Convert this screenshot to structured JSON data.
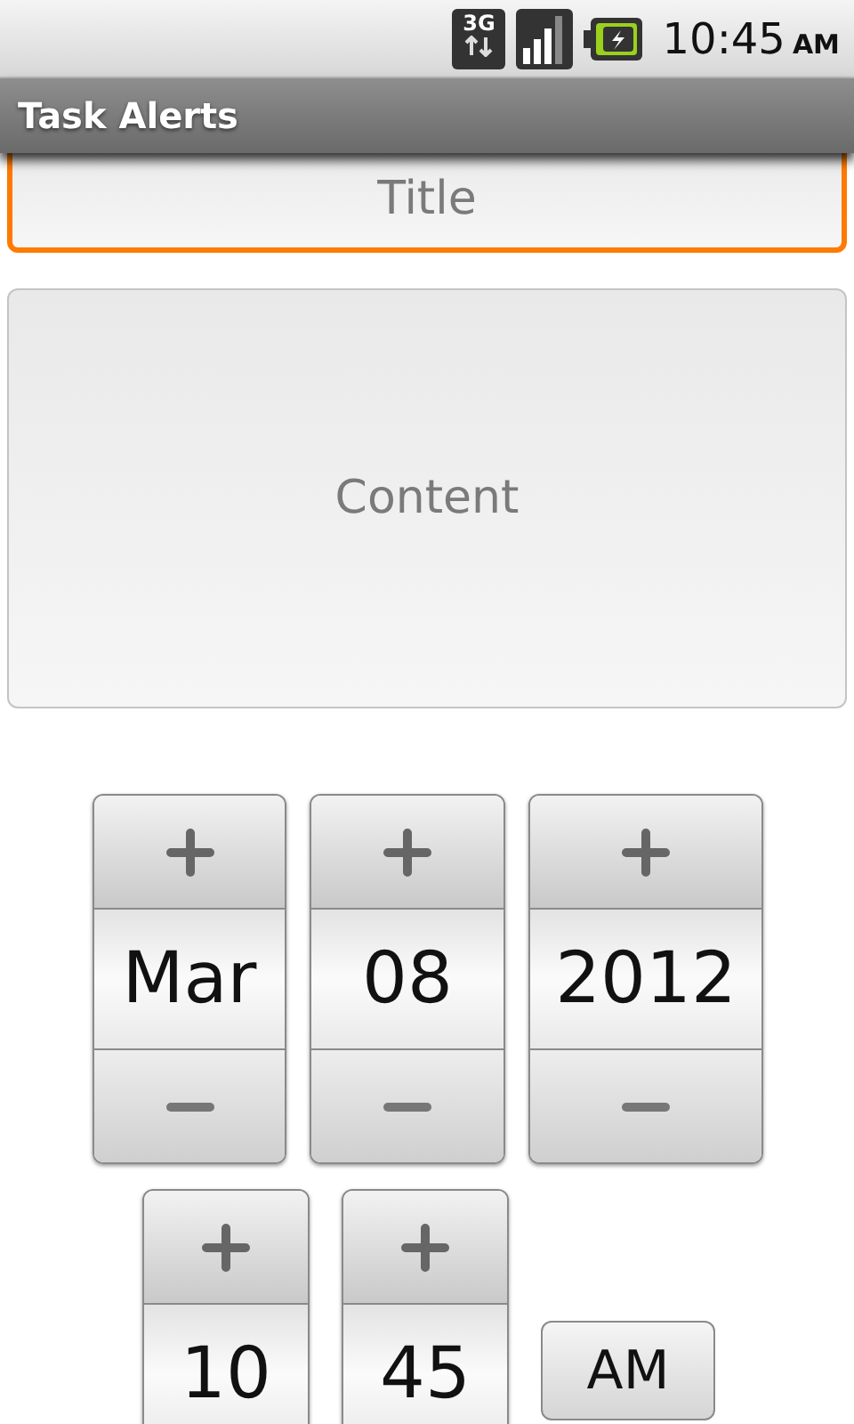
{
  "status_bar": {
    "network": "3G",
    "time": "10:45",
    "meridiem": "AM"
  },
  "title_bar": {
    "title": "Task Alerts"
  },
  "title_field": {
    "placeholder": "Title",
    "focused": true
  },
  "content_field": {
    "placeholder": "Content",
    "focused": false
  },
  "date_picker": [
    {
      "value": "Mar"
    },
    {
      "value": "08"
    },
    {
      "value": "2012"
    }
  ],
  "time_picker": [
    {
      "value": "10"
    },
    {
      "value": "45"
    }
  ],
  "meridiem_button": {
    "label": "AM"
  }
}
